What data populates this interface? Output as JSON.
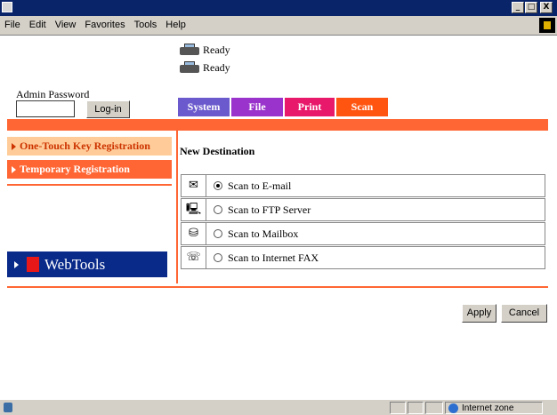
{
  "menu": [
    "File",
    "Edit",
    "View",
    "Favorites",
    "Tools",
    "Help"
  ],
  "window_controls": [
    "_",
    "□",
    "X"
  ],
  "status": [
    "Ready",
    "Ready"
  ],
  "admin": {
    "label": "Admin Password",
    "login_label": "Log-in",
    "password_value": ""
  },
  "tabs": [
    "System",
    "File",
    "Print",
    "Scan"
  ],
  "nav": {
    "items": [
      "One-Touch Key Registration",
      "Temporary Registration"
    ],
    "active_index": 0,
    "webtools_label": "WebTools"
  },
  "main": {
    "heading": "New Destination",
    "options": [
      {
        "icon": "envelope-icon",
        "glyph": "✉",
        "label": "Scan to E-mail",
        "selected": true
      },
      {
        "icon": "computer-icon",
        "glyph": "🖳",
        "label": "Scan to FTP Server",
        "selected": false
      },
      {
        "icon": "mailbox-icon",
        "glyph": "⛁",
        "label": "Scan to Mailbox",
        "selected": false
      },
      {
        "icon": "fax-icon",
        "glyph": "☏",
        "label": "Scan to Internet FAX",
        "selected": false
      }
    ]
  },
  "buttons": {
    "apply": "Apply",
    "cancel": "Cancel"
  },
  "statusbar": {
    "zone": "Internet zone"
  },
  "colors": {
    "accent": "#ff6633",
    "tab_system": "#6a5acd",
    "tab_file": "#9933cc",
    "tab_print": "#e8186a",
    "tab_scan": "#ff5511",
    "webtools_bg": "#0a2a8a"
  }
}
